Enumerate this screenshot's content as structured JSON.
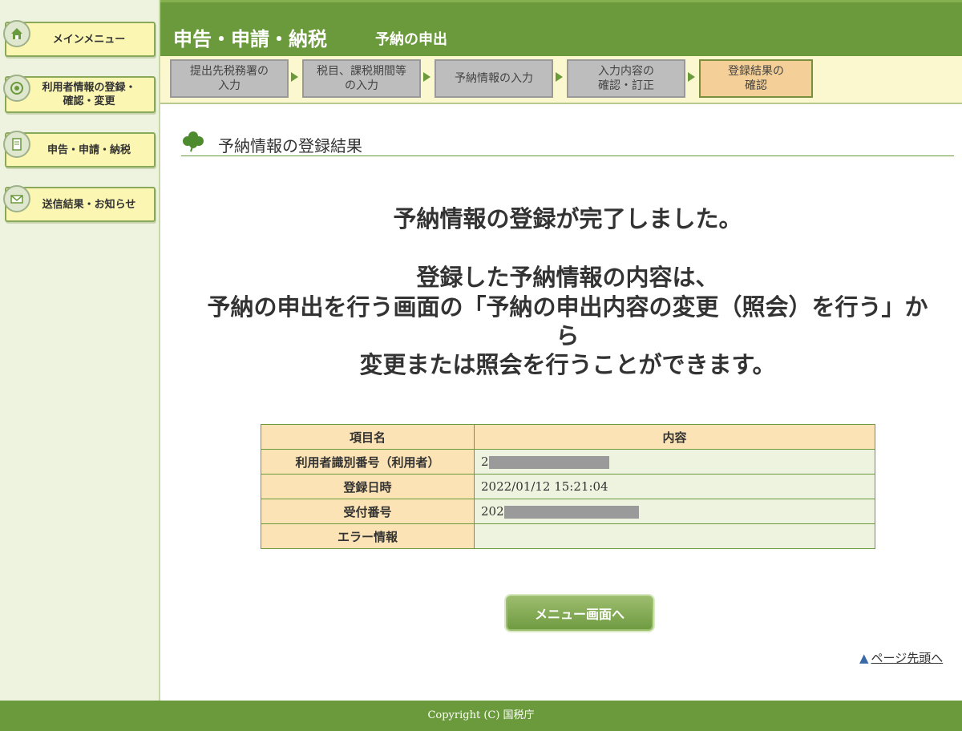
{
  "sidebar": {
    "items": [
      {
        "label": "メインメニュー",
        "icon": "home-icon"
      },
      {
        "label": "利用者情報の登録・\n確認・変更",
        "icon": "user-info-icon"
      },
      {
        "label": "申告・申請・納税",
        "icon": "document-icon"
      },
      {
        "label": "送信結果・お知らせ",
        "icon": "mail-icon"
      }
    ]
  },
  "header": {
    "title": "申告・申請・納税",
    "subtitle": "予納の申出"
  },
  "steps": [
    {
      "label": "提出先税務署の\n入力"
    },
    {
      "label": "税目、課税期間等\nの入力"
    },
    {
      "label": "予納情報の入力"
    },
    {
      "label": "入力内容の\n確認・訂正"
    },
    {
      "label": "登録結果の\n確認",
      "active": true
    }
  ],
  "section": {
    "title": "予納情報の登録結果"
  },
  "message": {
    "line1": "予納情報の登録が完了しました。",
    "line2": "登録した予納情報の内容は、",
    "line3": "予納の申出を行う画面の「予納の申出内容の変更（照会）を行う」か",
    "line4": "ら",
    "line5": "変更または照会を行うことができます。"
  },
  "table": {
    "headers": [
      "項目名",
      "内容"
    ],
    "rows": [
      {
        "key": "利用者識別番号（利用者）",
        "value": "2"
      },
      {
        "key": "登録日時",
        "value": "2022/01/12 15:21:04"
      },
      {
        "key": "受付番号",
        "value": "202"
      },
      {
        "key": "エラー情報",
        "value": ""
      }
    ]
  },
  "menu_button": {
    "label": "メニュー画面へ"
  },
  "page_top_link": {
    "label": "ページ先頭へ"
  },
  "footer": {
    "copyright": "Copyright (C) 国税庁"
  },
  "colors": {
    "brand_green": "#6b9a3c",
    "sidebar_bg": "#eef3df",
    "table_key_bg": "#fbe3b5",
    "active_step": "#f4cf98"
  }
}
